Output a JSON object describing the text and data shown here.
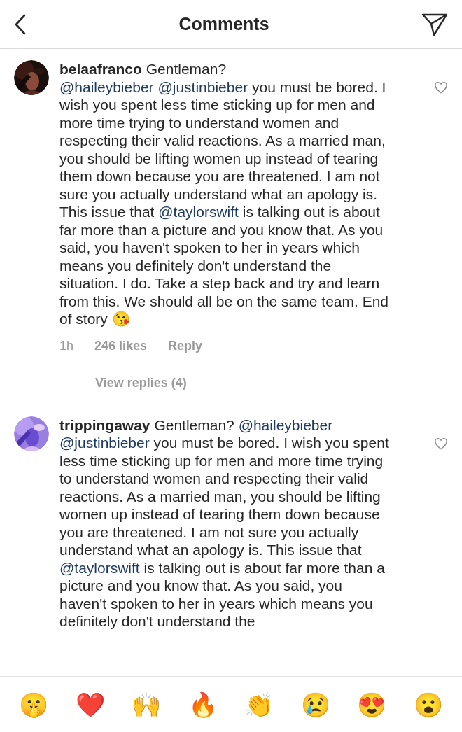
{
  "header": {
    "title": "Comments"
  },
  "comments": [
    {
      "username": "belaafranco",
      "liked": false,
      "body": [
        {
          "kind": "text",
          "text": "Gentleman?"
        },
        {
          "kind": "break"
        },
        {
          "kind": "mention",
          "text": "@haileybieber"
        },
        {
          "kind": "space"
        },
        {
          "kind": "mention",
          "text": "@justinbieber"
        },
        {
          "kind": "text",
          "text": " you must be bored. I wish you spent less time sticking up for men and more time trying to understand women and respecting their valid reactions. As a married man, you should be lifting women up instead of tearing them down because you are threatened. I am not sure you actually understand what an apology is. This issue that "
        },
        {
          "kind": "mention",
          "text": "@taylorswift"
        },
        {
          "kind": "text",
          "text": " is talking out is about far more than a picture and you know that. As you said, you haven't spoken to her in years which means you definitely don't understand the situation. I do. Take a step back and try and learn from this. We should all be on the same team. End of story 😘"
        }
      ],
      "time": "1h",
      "likes": "246 likes",
      "reply": "Reply",
      "view_replies": "View replies (4)"
    },
    {
      "username": "trippingaway",
      "liked": false,
      "body": [
        {
          "kind": "text",
          "text": "Gentleman? "
        },
        {
          "kind": "mention",
          "text": "@haileybieber"
        },
        {
          "kind": "space"
        },
        {
          "kind": "mention",
          "text": "@justinbieber"
        },
        {
          "kind": "text",
          "text": " you must be bored. I wish you spent less time sticking up for men and more time trying to understand women and respecting their valid reactions. As a married man, you should be lifting women up instead of tearing them down because you are threatened. I am not sure you actually understand what an apology is. This issue that "
        },
        {
          "kind": "mention",
          "text": "@taylorswift"
        },
        {
          "kind": "text",
          "text": " is talking out is about far more than a picture and you know that. As you said, you haven't spoken to her in years which means you definitely don't understand the"
        }
      ]
    }
  ],
  "emoji_bar": [
    "🤫",
    "❤️",
    "🙌",
    "🔥",
    "👏",
    "😢",
    "😍",
    "😮"
  ]
}
